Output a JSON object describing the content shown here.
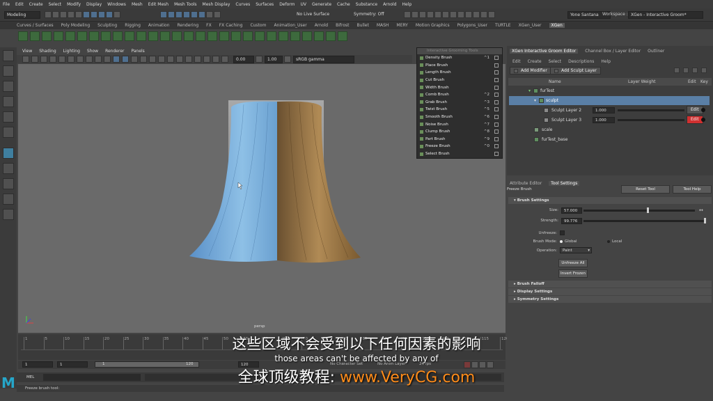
{
  "menubar": [
    "File",
    "Edit",
    "Create",
    "Select",
    "Modify",
    "Display",
    "Windows",
    "Mesh",
    "Edit Mesh",
    "Mesh Tools",
    "Mesh Display",
    "Curves",
    "Surfaces",
    "Deform",
    "UV",
    "Generate",
    "Cache",
    "Substance",
    "Arnold",
    "Help"
  ],
  "statusline": {
    "mode": "Modeling",
    "live_surface": "No Live Surface",
    "symmetry": "Symmetry: Off",
    "user": "Yone Santana",
    "workspace_label": "Workspace :",
    "workspace": "XGen - Interactive Groom*"
  },
  "shelf_tabs": [
    "Curves / Surfaces",
    "Poly Modeling",
    "Sculpting",
    "Rigging",
    "Animation",
    "Rendering",
    "FX",
    "FX Caching",
    "Custom",
    "Animation_User",
    "Arnold",
    "Bifrost",
    "Bullet",
    "MASH",
    "MERY",
    "Motion Graphics",
    "Polygons_User",
    "TURTLE",
    "XGen_User",
    "XGen"
  ],
  "viewport": {
    "menu": [
      "View",
      "Shading",
      "Lighting",
      "Show",
      "Renderer",
      "Panels"
    ],
    "value1": "0.00",
    "value2": "1.00",
    "colorspace": "sRGB gamma",
    "camera": "persp",
    "colors": {
      "blue_hair": "#6aa8d8",
      "brown_hair": "#8a6a3a"
    }
  },
  "brush_menu": {
    "title": "Interactive Grooming Tools",
    "items": [
      {
        "label": "Density Brush",
        "shortcut": "^1"
      },
      {
        "label": "Place Brush",
        "shortcut": ""
      },
      {
        "label": "Length Brush",
        "shortcut": ""
      },
      {
        "label": "Cut Brush",
        "shortcut": ""
      },
      {
        "label": "Width Brush",
        "shortcut": ""
      },
      {
        "label": "Comb Brush",
        "shortcut": "^2"
      },
      {
        "label": "Grab Brush",
        "shortcut": "^3"
      },
      {
        "label": "Twist Brush",
        "shortcut": "^5"
      },
      {
        "label": "Smooth Brush",
        "shortcut": "^6"
      },
      {
        "label": "Noise Brush",
        "shortcut": "^7"
      },
      {
        "label": "Clump Brush",
        "shortcut": "^8"
      },
      {
        "label": "Part Brush",
        "shortcut": "^9"
      },
      {
        "label": "Freeze Brush",
        "shortcut": "^0"
      },
      {
        "label": "Select Brush",
        "shortcut": ""
      }
    ]
  },
  "timeline": {
    "ticks": [
      "1",
      "5",
      "10",
      "15",
      "20",
      "25",
      "30",
      "35",
      "40",
      "45",
      "50",
      "55",
      "60",
      "65",
      "70",
      "75",
      "80",
      "85",
      "90",
      "95",
      "100",
      "105",
      "110",
      "115",
      "120"
    ],
    "start": "1",
    "start2": "1",
    "range_start": "1",
    "range_end": "120",
    "end": "120",
    "char_set": "No Character Set",
    "anim_layer": "No Anim Layer",
    "fps": "24 fps",
    "mel": "MEL",
    "help": "Freeze brush tool:"
  },
  "xgen_panel": {
    "tabs": [
      "XGen Interactive Groom Editor",
      "Channel Box / Layer Editor",
      "Outliner"
    ],
    "menu": [
      "Edit",
      "Create",
      "Select",
      "Descriptions",
      "Help"
    ],
    "add_modifier": "Add Modifier",
    "add_sculpt_layer": "Add Sculpt Layer",
    "headers": {
      "name": "Name",
      "layer_weight": "Layer Weight",
      "edit": "Edit",
      "key": "Key"
    },
    "rows": {
      "furtest": "furTest",
      "sculpt": "sculpt",
      "layer2": "Sculpt Layer 2",
      "layer2_w": "1.000",
      "layer3": "Sculpt Layer 3",
      "layer3_w": "1.000",
      "scale": "scale",
      "base": "furTest_base",
      "edit": "Edit"
    }
  },
  "attr_panel": {
    "tabs": [
      "Attribute Editor",
      "Tool Settings"
    ],
    "tool_name": "Freeze Brush",
    "reset_tool": "Reset Tool",
    "tool_help": "Tool Help",
    "brush_settings": "Brush Settings",
    "size_label": "Size:",
    "size": "57.000",
    "size_level": 0.57,
    "strength_label": "Strength:",
    "strength": "99.776",
    "strength_level": 0.998,
    "unfreeze_label": "Unfreeze:",
    "brush_mode_label": "Brush Mode:",
    "mode_global": "Global",
    "mode_local": "Local",
    "operation_label": "Operation:",
    "operation": "Paint",
    "unfreeze_all": "Unfreeze All",
    "invert_frozen": "Invert Frozen",
    "sections": [
      "Brush Falloff",
      "Display Settings",
      "Symmetry Settings"
    ]
  },
  "subtitles": {
    "zh": "这些区域不会受到以下任何因素的影响",
    "en": "those areas can't be affected by any of",
    "brand_prefix": "全球顶级教程: ",
    "brand_url": "www.VeryCG.com"
  },
  "logo": "M"
}
